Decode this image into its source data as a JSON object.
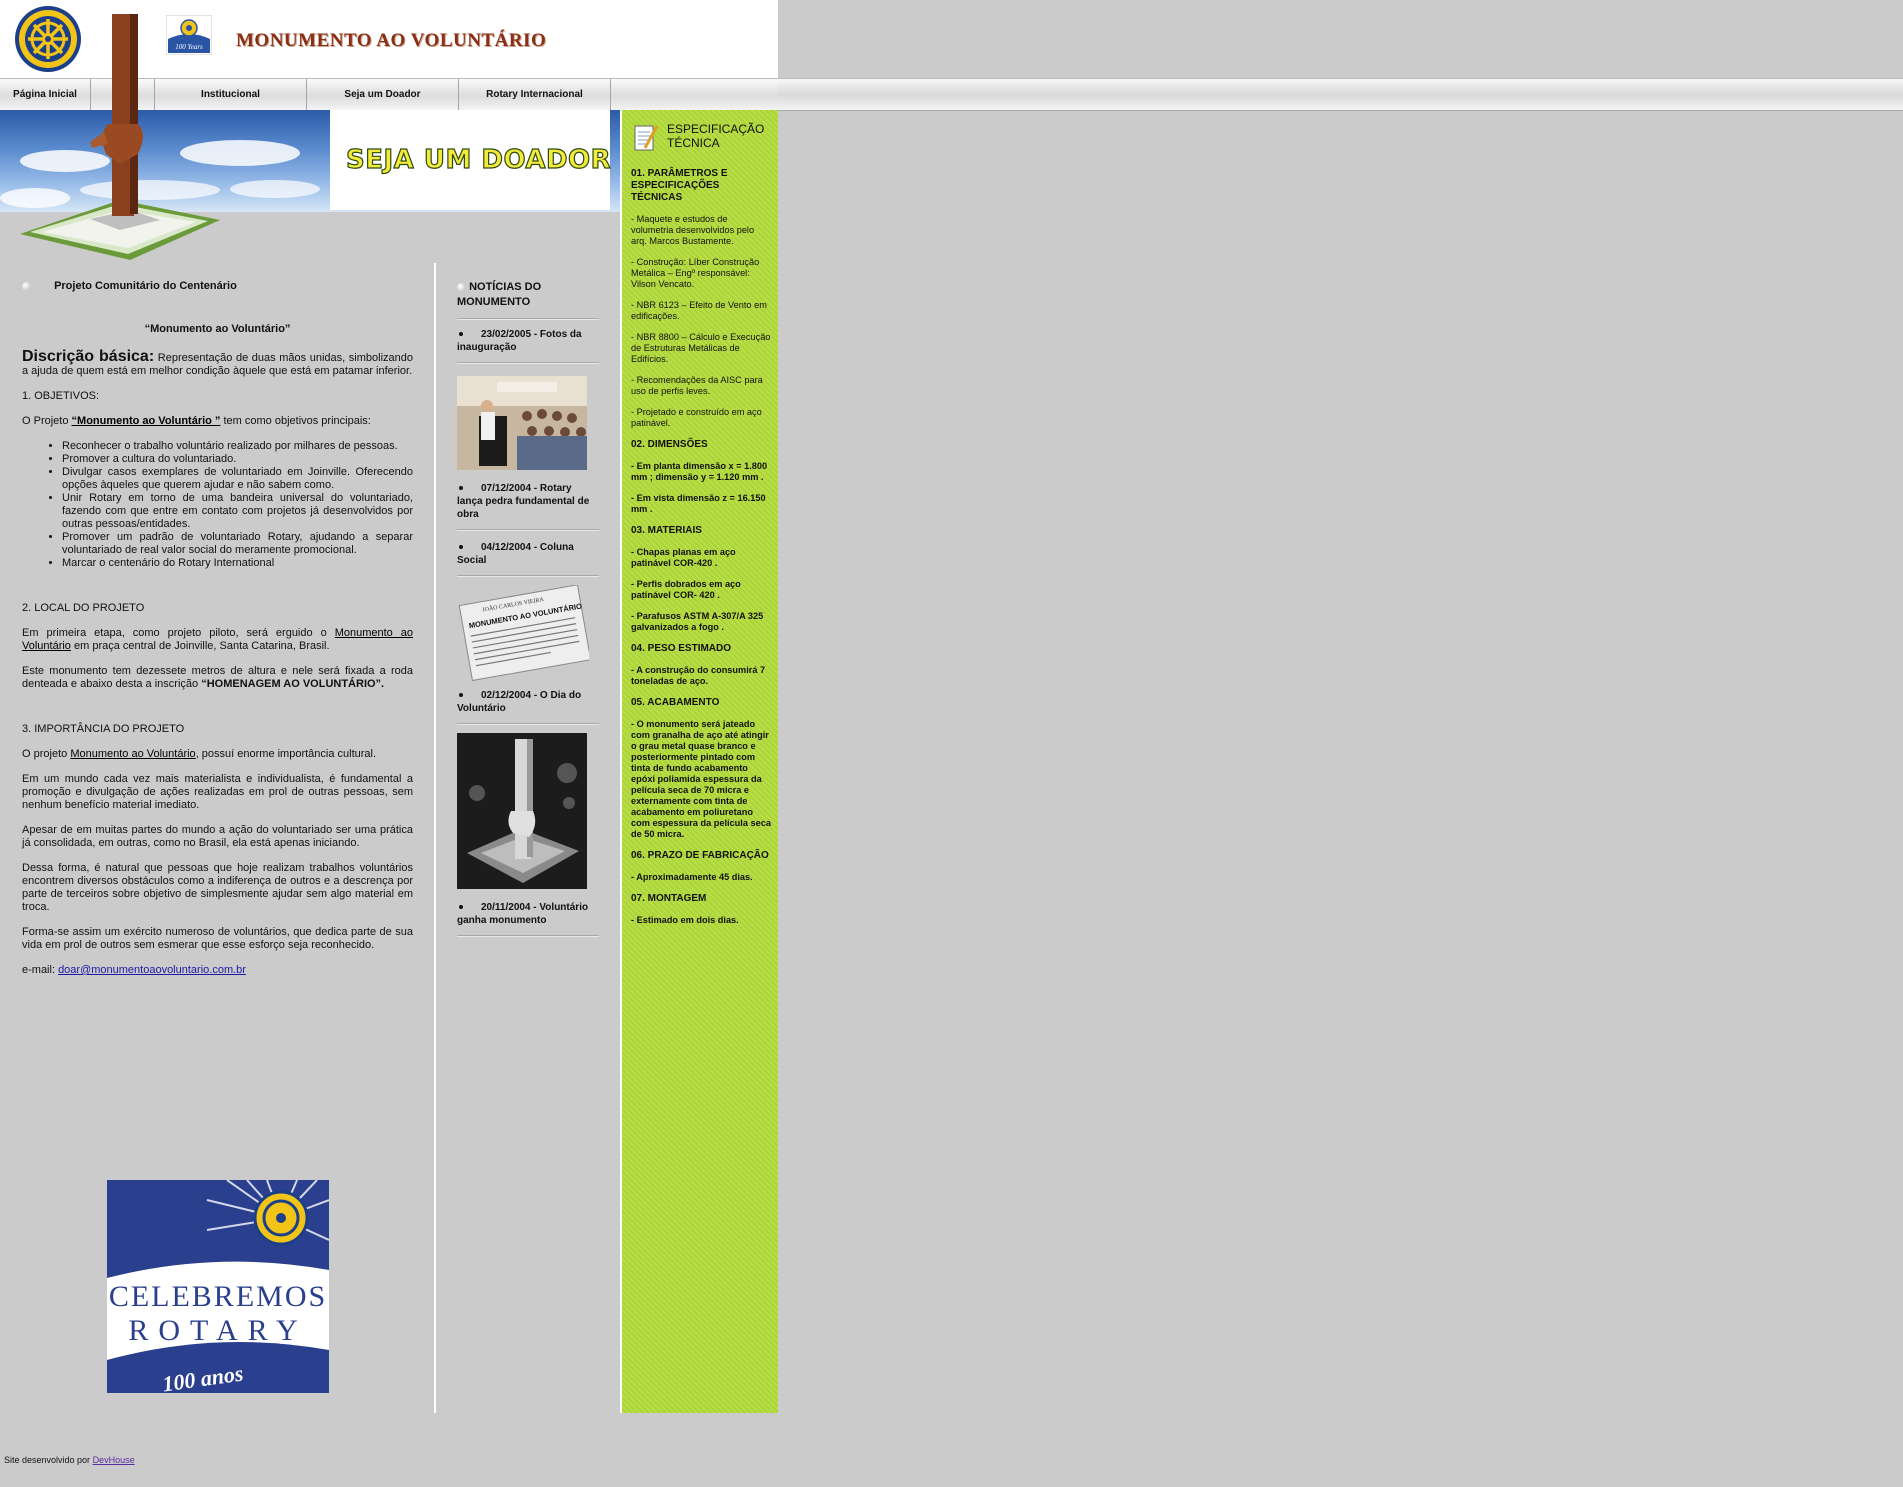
{
  "header": {
    "title": "MONUMENTO AO VOLUNTÁRIO"
  },
  "nav": {
    "items": [
      "Página Inicial",
      "",
      "Institucional",
      "Seja um Doador",
      "Rotary Internacional",
      ""
    ]
  },
  "banner": {
    "heading": "SEJA UM DOADOR"
  },
  "main": {
    "section_title": "Projeto Comunitário do Centenário",
    "subtitle": "“Monumento ao Voluntário”",
    "desc_label": "Discrição básica:",
    "desc_text": " Representação de duas mãos unidas, simbolizando a ajuda de quem está em melhor condição àquele que está em patamar inferior.",
    "obj_heading": "1. OBJETIVOS:",
    "obj_intro_pre": "O Projeto ",
    "obj_intro_link": "“Monumento ao Voluntário ”",
    "obj_intro_post": " tem como objetivos principais:",
    "objectives": [
      "Reconhecer o trabalho voluntário realizado por milhares de pessoas.",
      "Promover a cultura do voluntariado.",
      "Divulgar casos exemplares de voluntariado em Joinville. Oferecendo opções àqueles que querem ajudar e não sabem como.",
      "Unir Rotary em torno de uma bandeira universal do voluntariado, fazendo com que entre em contato com projetos já desenvolvidos por outras pessoas/entidades.",
      "Promover um padrão de voluntariado Rotary, ajudando a separar voluntariado de real valor social do meramente promocional.",
      "Marcar o centenário do Rotary International"
    ],
    "local_heading": "2. LOCAL DO PROJETO",
    "local_p1_pre": "Em primeira etapa, como projeto piloto, será erguido o ",
    "local_p1_link": "Monumento ao Voluntário",
    "local_p1_post": " em praça central de Joinville, Santa Catarina, Brasil.",
    "local_p2_pre": "Este monumento tem dezessete metros de altura e nele será fixada a roda denteada e abaixo desta a inscrição ",
    "local_p2_bold": "“HOMENAGEM AO VOLUNTÁRIO”.",
    "imp_heading": "3. IMPORTÂNCIA DO PROJETO",
    "imp_p1_pre": "O projeto ",
    "imp_p1_link": "Monumento ao Voluntário",
    "imp_p1_post": ", possuí enorme importância cultural.",
    "imp_p2": "Em um mundo cada vez mais materialista e individualista, é fundamental a promoção e divulgação de ações realizadas em prol de outras pessoas, sem nenhum benefício material imediato.",
    "imp_p3": "Apesar de em muitas partes do mundo a ação do voluntariado ser uma prática já consolidada, em outras, como no Brasil, ela está apenas iniciando.",
    "imp_p4": "Dessa forma, é natural que pessoas que hoje realizam trabalhos voluntários encontrem diversos obstáculos como a indiferença de outros e a descrença por parte de terceiros sobre objetivo de simplesmente ajudar sem algo material em troca.",
    "imp_p5": "Forma-se assim um exército numeroso de voluntários, que dedica parte de sua vida em prol de outros sem esmerar que esse esforço seja reconhecido.",
    "email_label": "e-mail: ",
    "email": "doar@monumentoaovoluntario.com.br",
    "celebremos_line1": "CELEBREMOS",
    "celebremos_line2": "ROTARY",
    "celebremos_line3": "100 anos"
  },
  "news": {
    "title": "NOTÍCIAS DO MONUMENTO",
    "items": [
      "23/02/2005 - Fotos da inauguração",
      "07/12/2004 - Rotary lança pedra fundamental de obra",
      "04/12/2004 - Coluna Social",
      "02/12/2004 - O Dia do Voluntário",
      "20/11/2004 - Voluntário ganha monumento"
    ],
    "clipping_header": "JOÃO CARLOS VIEIRA",
    "clipping_title": "MONUMENTO AO VOLUNTÁRIO"
  },
  "spec": {
    "title": "ESPECIFICAÇÃO TÉCNICA",
    "s1": "01. PARÂMETROS E ESPECIFICAÇÕES TÉCNICAS",
    "s1_items": [
      "- Maquete e estudos de volumetria desenvolvidos pelo arq. Marcos Bustamente.",
      "- Construção: Líber Construção Metálica – Engº responsável: Vilson Vencato.",
      "- NBR 6123 – Efeito de Vento em edificações.",
      "- NBR 8800 – Cálculo e Execução de Estruturas Metálicas de Edifícios.",
      "- Recomendações da AISC para uso de perfis leves.",
      "- Projetado e construído em aço patinável."
    ],
    "s2": "02. DIMENSÕES",
    "s2_items": [
      "- Em planta dimensão x = 1.800 mm ; dimensão y = 1.120 mm .",
      "- Em vista dimensão z = 16.150 mm ."
    ],
    "s3": "03. MATERIAIS",
    "s3_items": [
      "- Chapas planas em aço patinável COR-420 .",
      "- Perfis dobrados em aço patinável COR- 420 .",
      "- Parafusos ASTM A-307/A 325 galvanizados a fogo ."
    ],
    "s4": "04. PESO ESTIMADO",
    "s4_items": [
      "- A construção do consumirá 7 toneladas de aço."
    ],
    "s5": "05. ACABAMENTO",
    "s5_items": [
      "- O monumento será jateado com granalha de aço até atingir o grau metal quase branco e posteriormente pintado com tinta de fundo acabamento epóxi poliamida espessura da película seca de 70 micra e externamente com tinta de acabamento em poliuretano com espessura da película seca de 50 micra."
    ],
    "s6": "06. PRAZO DE FABRICAÇÃO",
    "s6_items": [
      "- Aproximadamente 45 dias."
    ],
    "s7": "07. MONTAGEM",
    "s7_items": [
      "- Estimado em dois dias."
    ]
  },
  "footer": {
    "text": "Site desenvolvido por ",
    "link": "DevHouse"
  }
}
